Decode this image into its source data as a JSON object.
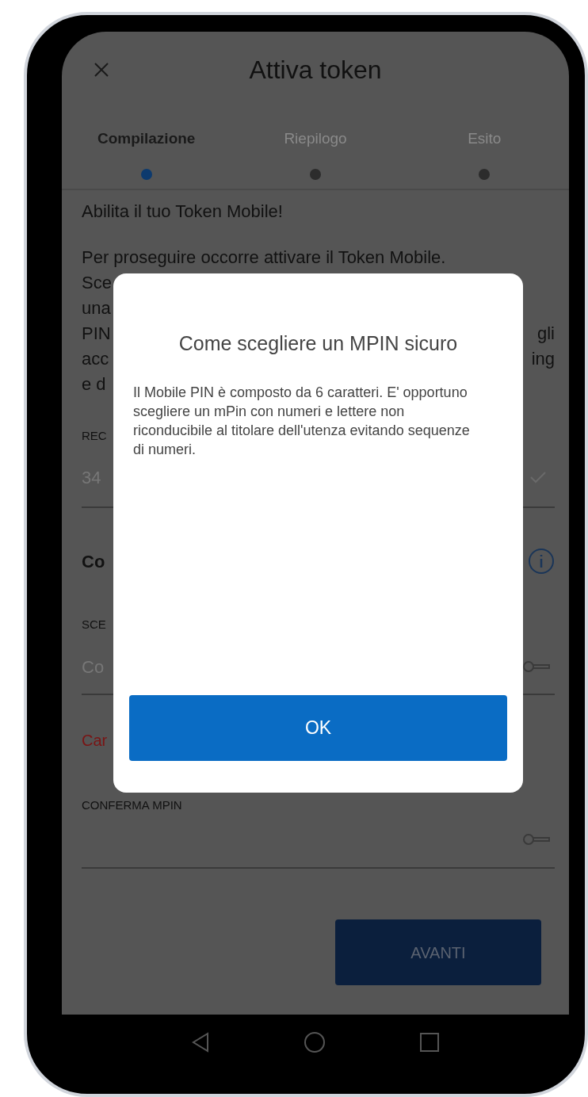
{
  "header": {
    "title": "Attiva token"
  },
  "steps": [
    {
      "label": "Compilazione",
      "selected": true
    },
    {
      "label": "Riepilogo",
      "selected": false
    },
    {
      "label": "Esito",
      "selected": false
    }
  ],
  "intro": "Abilita il tuo Token Mobile!",
  "paragraph_lines": [
    {
      "left": "Per proseguire occorre attivare il Token Mobile."
    },
    {
      "left": "Sce"
    },
    {
      "left": "una"
    },
    {
      "left": "PIN",
      "right": "gli"
    },
    {
      "left": "acc",
      "right": "ing"
    },
    {
      "left": "e d"
    }
  ],
  "phone_field": {
    "label": "REC",
    "value": "34",
    "valid": true
  },
  "section_title": "Co",
  "mpin_field": {
    "label": "SCE",
    "placeholder": "Co"
  },
  "error": "Car",
  "confirm_field": {
    "label": "CONFERMA MPIN"
  },
  "next_button": {
    "label": "AVANTI",
    "disabled": true
  },
  "dialog": {
    "title": "Come scegliere un MPIN sicuro",
    "body": "Il Mobile PIN è composto da 6 caratteri. E' opportuno scegliere un mPin con numeri e lettere non riconducibile al titolare dell'utenza evitando sequenze di numeri.",
    "button": "OK"
  }
}
